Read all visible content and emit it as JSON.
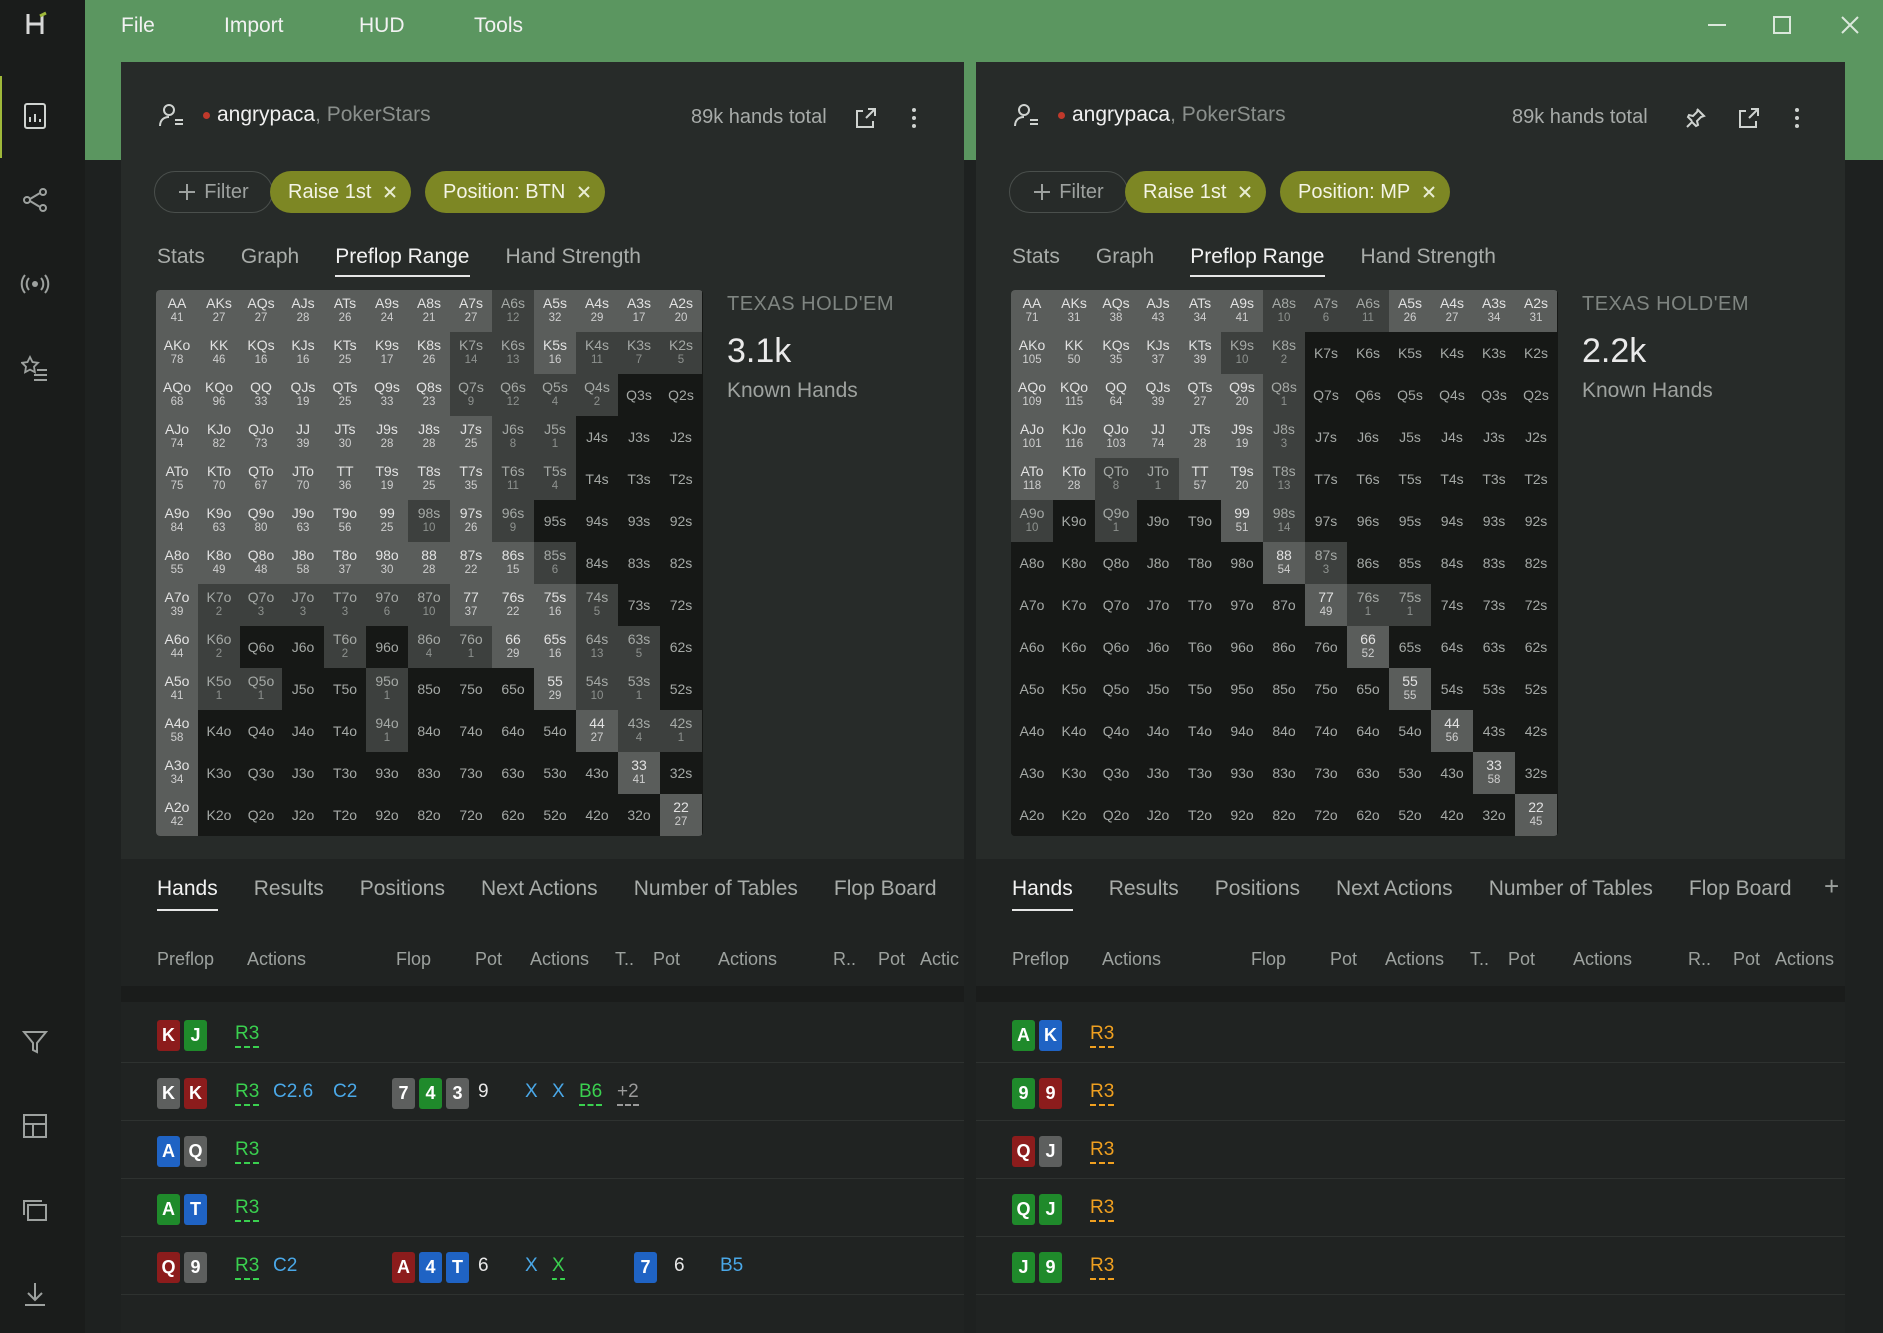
{
  "menu": {
    "items": [
      "File",
      "Import",
      "HUD",
      "Tools"
    ]
  },
  "grid_labels": [
    [
      "AA",
      "AKs",
      "AQs",
      "AJs",
      "ATs",
      "A9s",
      "A8s",
      "A7s",
      "A6s",
      "A5s",
      "A4s",
      "A3s",
      "A2s"
    ],
    [
      "AKo",
      "KK",
      "KQs",
      "KJs",
      "KTs",
      "K9s",
      "K8s",
      "K7s",
      "K6s",
      "K5s",
      "K4s",
      "K3s",
      "K2s"
    ],
    [
      "AQo",
      "KQo",
      "QQ",
      "QJs",
      "QTs",
      "Q9s",
      "Q8s",
      "Q7s",
      "Q6s",
      "Q5s",
      "Q4s",
      "Q3s",
      "Q2s"
    ],
    [
      "AJo",
      "KJo",
      "QJo",
      "JJ",
      "JTs",
      "J9s",
      "J8s",
      "J7s",
      "J6s",
      "J5s",
      "J4s",
      "J3s",
      "J2s"
    ],
    [
      "ATo",
      "KTo",
      "QTo",
      "JTo",
      "TT",
      "T9s",
      "T8s",
      "T7s",
      "T6s",
      "T5s",
      "T4s",
      "T3s",
      "T2s"
    ],
    [
      "A9o",
      "K9o",
      "Q9o",
      "J9o",
      "T9o",
      "99",
      "98s",
      "97s",
      "96s",
      "95s",
      "94s",
      "93s",
      "92s"
    ],
    [
      "A8o",
      "K8o",
      "Q8o",
      "J8o",
      "T8o",
      "98o",
      "88",
      "87s",
      "86s",
      "85s",
      "84s",
      "83s",
      "82s"
    ],
    [
      "A7o",
      "K7o",
      "Q7o",
      "J7o",
      "T7o",
      "97o",
      "87o",
      "77",
      "76s",
      "75s",
      "74s",
      "73s",
      "72s"
    ],
    [
      "A6o",
      "K6o",
      "Q6o",
      "J6o",
      "T6o",
      "96o",
      "86o",
      "76o",
      "66",
      "65s",
      "64s",
      "63s",
      "62s"
    ],
    [
      "A5o",
      "K5o",
      "Q5o",
      "J5o",
      "T5o",
      "95o",
      "85o",
      "75o",
      "65o",
      "55",
      "54s",
      "53s",
      "52s"
    ],
    [
      "A4o",
      "K4o",
      "Q4o",
      "J4o",
      "T4o",
      "94o",
      "84o",
      "74o",
      "64o",
      "54o",
      "44",
      "43s",
      "42s"
    ],
    [
      "A3o",
      "K3o",
      "Q3o",
      "J3o",
      "T3o",
      "93o",
      "83o",
      "73o",
      "63o",
      "53o",
      "43o",
      "33",
      "32s"
    ],
    [
      "A2o",
      "K2o",
      "Q2o",
      "J2o",
      "T2o",
      "92o",
      "82o",
      "72o",
      "62o",
      "52o",
      "42o",
      "32o",
      "22"
    ]
  ],
  "panels": [
    {
      "user": "angrypaca",
      "site": ", PokerStars",
      "hands_total": "89k hands total",
      "filter_label": "Filter",
      "chips": [
        "Raise 1st",
        "Position: BTN"
      ],
      "tabs": [
        "Stats",
        "Graph",
        "Preflop Range",
        "Hand Strength"
      ],
      "range_game": "TEXAS HOLD'EM",
      "known_count": "3.1k",
      "known_label": "Known Hands",
      "counts": [
        [
          41,
          27,
          27,
          28,
          26,
          24,
          21,
          27,
          12,
          32,
          29,
          17,
          20
        ],
        [
          78,
          46,
          16,
          16,
          25,
          17,
          26,
          14,
          13,
          16,
          11,
          7,
          5
        ],
        [
          68,
          96,
          33,
          19,
          25,
          33,
          23,
          9,
          12,
          4,
          2,
          null,
          null
        ],
        [
          74,
          82,
          73,
          39,
          30,
          28,
          28,
          25,
          8,
          1,
          null,
          null,
          null
        ],
        [
          75,
          70,
          67,
          70,
          36,
          19,
          25,
          35,
          11,
          4,
          null,
          null,
          null
        ],
        [
          84,
          63,
          80,
          63,
          56,
          25,
          10,
          26,
          9,
          null,
          null,
          null,
          null
        ],
        [
          55,
          49,
          48,
          58,
          37,
          30,
          28,
          22,
          15,
          6,
          null,
          null,
          null
        ],
        [
          39,
          2,
          3,
          3,
          3,
          6,
          10,
          37,
          22,
          16,
          5,
          null,
          null
        ],
        [
          44,
          2,
          null,
          null,
          2,
          null,
          4,
          1,
          29,
          16,
          13,
          5,
          null
        ],
        [
          41,
          1,
          1,
          null,
          null,
          1,
          null,
          null,
          null,
          29,
          10,
          1,
          null
        ],
        [
          58,
          null,
          null,
          null,
          null,
          1,
          null,
          null,
          null,
          null,
          27,
          4,
          1
        ],
        [
          34,
          null,
          null,
          null,
          null,
          null,
          null,
          null,
          null,
          null,
          null,
          41,
          null
        ],
        [
          42,
          null,
          null,
          null,
          null,
          null,
          null,
          null,
          null,
          null,
          null,
          null,
          27
        ]
      ],
      "hands_tabs": [
        "Hands",
        "Results",
        "Positions",
        "Next Actions",
        "Number of Tables",
        "Flop Board"
      ],
      "col_headers": [
        "Preflop",
        "Actions",
        "Flop",
        "Pot",
        "Actions",
        "T..",
        "Pot",
        "Actions",
        "R..",
        "Pot",
        "Actic"
      ],
      "rows": [
        {
          "cards": [
            [
              "K",
              "rr"
            ],
            [
              "J",
              "gg"
            ]
          ],
          "acts": [
            {
              "t": "R3",
              "c": "cg",
              "u": 1
            }
          ]
        },
        {
          "cards": [
            [
              "K",
              "gy"
            ],
            [
              "K",
              "rr"
            ]
          ],
          "acts": [
            {
              "t": "R3",
              "c": "cg",
              "u": 1
            },
            {
              "t": "C2.6",
              "c": "cb"
            },
            {
              "t": "C2",
              "c": "cb"
            }
          ],
          "flop": [
            [
              "7",
              "gy"
            ],
            [
              "4",
              "gg"
            ],
            [
              "3",
              "gy"
            ]
          ],
          "pot": "9",
          "facts": [
            {
              "t": "X",
              "c": "cb"
            },
            {
              "t": "X",
              "c": "cb"
            },
            {
              "t": "B6",
              "c": "cg",
              "u": 1
            },
            {
              "t": "+2",
              "c": "cm",
              "u": 1
            }
          ]
        },
        {
          "cards": [
            [
              "A",
              "bb"
            ],
            [
              "Q",
              "gy"
            ]
          ],
          "acts": [
            {
              "t": "R3",
              "c": "cg",
              "u": 1
            }
          ]
        },
        {
          "cards": [
            [
              "A",
              "gg"
            ],
            [
              "T",
              "bb"
            ]
          ],
          "acts": [
            {
              "t": "R3",
              "c": "cg",
              "u": 1
            }
          ]
        },
        {
          "cards": [
            [
              "Q",
              "rr"
            ],
            [
              "9",
              "gy"
            ]
          ],
          "acts": [
            {
              "t": "R3",
              "c": "cg",
              "u": 1
            },
            {
              "t": "C2",
              "c": "cb"
            }
          ],
          "flop": [
            [
              "A",
              "rr"
            ],
            [
              "4",
              "bb"
            ],
            [
              "T",
              "bb"
            ]
          ],
          "pot": "6",
          "facts": [
            {
              "t": "X",
              "c": "cb"
            },
            {
              "t": "X",
              "c": "cg",
              "u": 1
            }
          ],
          "turn": [
            [
              "7",
              "bb"
            ]
          ],
          "tpot": "6",
          "tacts": [
            {
              "t": "B5",
              "c": "cb"
            }
          ]
        }
      ]
    },
    {
      "user": "angrypaca",
      "site": ", PokerStars",
      "hands_total": "89k hands total",
      "filter_label": "Filter",
      "chips": [
        "Raise 1st",
        "Position: MP"
      ],
      "tabs": [
        "Stats",
        "Graph",
        "Preflop Range",
        "Hand Strength"
      ],
      "range_game": "TEXAS HOLD'EM",
      "known_count": "2.2k",
      "known_label": "Known Hands",
      "counts": [
        [
          71,
          31,
          38,
          43,
          34,
          41,
          10,
          6,
          11,
          26,
          27,
          34,
          31
        ],
        [
          105,
          50,
          35,
          37,
          39,
          10,
          2,
          null,
          null,
          null,
          null,
          null,
          null
        ],
        [
          109,
          115,
          64,
          39,
          27,
          20,
          1,
          null,
          null,
          null,
          null,
          null,
          null
        ],
        [
          101,
          116,
          103,
          74,
          28,
          19,
          3,
          null,
          null,
          null,
          null,
          null,
          null
        ],
        [
          118,
          28,
          8,
          1,
          57,
          20,
          13,
          null,
          null,
          null,
          null,
          null,
          null
        ],
        [
          10,
          null,
          1,
          null,
          null,
          51,
          14,
          null,
          null,
          null,
          null,
          null,
          null
        ],
        [
          null,
          null,
          null,
          null,
          null,
          null,
          54,
          3,
          null,
          null,
          null,
          null,
          null
        ],
        [
          null,
          null,
          null,
          null,
          null,
          null,
          null,
          49,
          1,
          1,
          null,
          null,
          null
        ],
        [
          null,
          null,
          null,
          null,
          null,
          null,
          null,
          null,
          52,
          null,
          null,
          null,
          null
        ],
        [
          null,
          null,
          null,
          null,
          null,
          null,
          null,
          null,
          null,
          55,
          null,
          null,
          null
        ],
        [
          null,
          null,
          null,
          null,
          null,
          null,
          null,
          null,
          null,
          null,
          56,
          null,
          null
        ],
        [
          null,
          null,
          null,
          null,
          null,
          null,
          null,
          null,
          null,
          null,
          null,
          58,
          null
        ],
        [
          null,
          null,
          null,
          null,
          null,
          null,
          null,
          null,
          null,
          null,
          null,
          null,
          45
        ]
      ],
      "hands_tabs": [
        "Hands",
        "Results",
        "Positions",
        "Next Actions",
        "Number of Tables",
        "Flop Board"
      ],
      "col_headers": [
        "Preflop",
        "Actions",
        "Flop",
        "Pot",
        "Actions",
        "T..",
        "Pot",
        "Actions",
        "R..",
        "Pot",
        "Actions"
      ],
      "rows": [
        {
          "cards": [
            [
              "A",
              "gg"
            ],
            [
              "K",
              "bb"
            ]
          ],
          "acts": [
            {
              "t": "R3",
              "c": "co",
              "u": 1
            }
          ]
        },
        {
          "cards": [
            [
              "9",
              "gg"
            ],
            [
              "9",
              "rr"
            ]
          ],
          "acts": [
            {
              "t": "R3",
              "c": "co",
              "u": 1
            }
          ]
        },
        {
          "cards": [
            [
              "Q",
              "rr"
            ],
            [
              "J",
              "gy"
            ]
          ],
          "acts": [
            {
              "t": "R3",
              "c": "co",
              "u": 1
            }
          ]
        },
        {
          "cards": [
            [
              "Q",
              "gg"
            ],
            [
              "J",
              "gg"
            ]
          ],
          "acts": [
            {
              "t": "R3",
              "c": "co",
              "u": 1
            }
          ]
        },
        {
          "cards": [
            [
              "J",
              "gg"
            ],
            [
              "9",
              "gg"
            ]
          ],
          "acts": [
            {
              "t": "R3",
              "c": "co",
              "u": 1
            }
          ]
        }
      ]
    }
  ]
}
